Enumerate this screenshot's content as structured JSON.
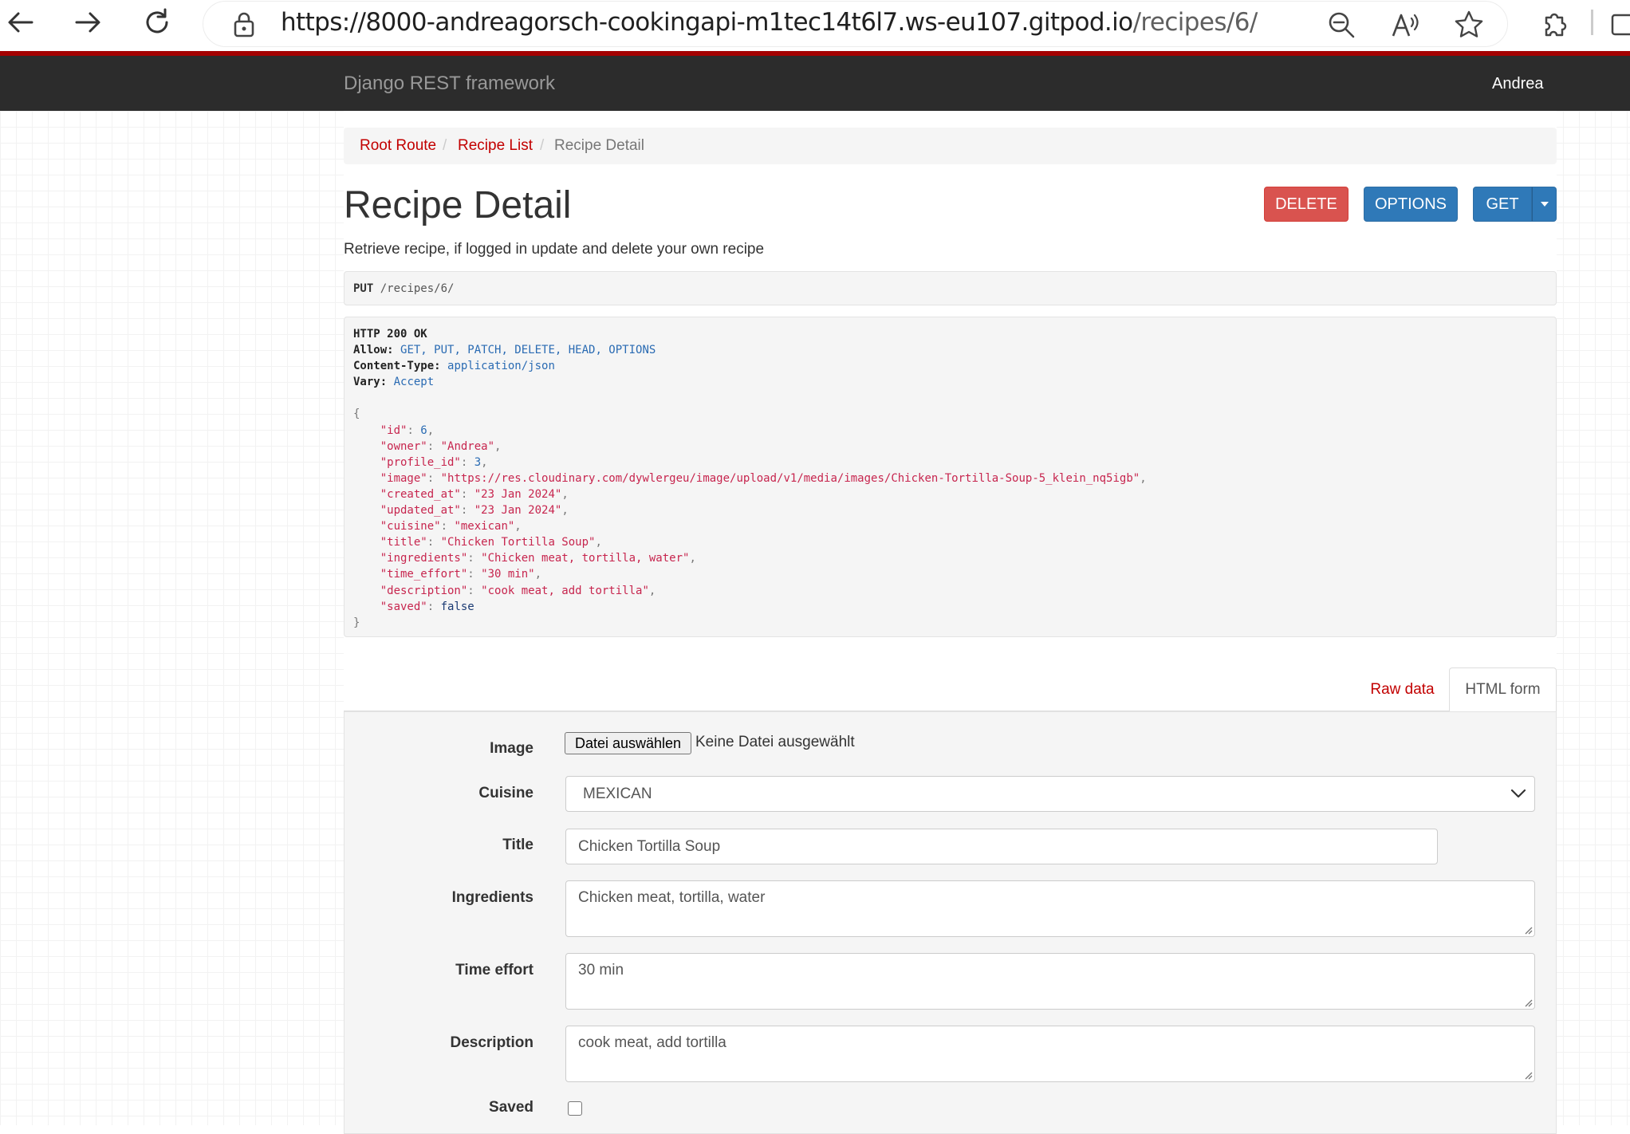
{
  "browser": {
    "url_host": "https://8000-andreagorsch-cookingapi-m1tec14t6l7.ws-eu107.gitpod.io",
    "url_path": "/recipes/6/",
    "icons": [
      "back-icon",
      "forward-icon",
      "reload-icon",
      "lock-icon",
      "zoom-out-icon",
      "read-aloud-icon",
      "favorite-star-icon",
      "extensions-icon",
      "sidebar-icon"
    ]
  },
  "navbar": {
    "brand": "Django REST framework",
    "user": "Andrea"
  },
  "breadcrumb": [
    {
      "label": "Root Route",
      "sep": "/"
    },
    {
      "label": "Recipe List",
      "sep": "/"
    },
    {
      "label": "Recipe Detail"
    }
  ],
  "page": {
    "title": "Recipe Detail",
    "description": "Retrieve recipe, if logged in update and delete your own recipe"
  },
  "buttons": {
    "delete": "DELETE",
    "options": "OPTIONS",
    "get": "GET"
  },
  "request": {
    "method": "PUT",
    "path": "/recipes/6/"
  },
  "response": {
    "status": "HTTP 200 OK",
    "headers": [
      {
        "name": "Allow:",
        "value": "GET, PUT, PATCH, DELETE, HEAD, OPTIONS"
      },
      {
        "name": "Content-Type:",
        "value": "application/json"
      },
      {
        "name": "Vary:",
        "value": "Accept"
      }
    ],
    "open_brace": "{",
    "close_brace": "}",
    "fields": [
      {
        "key": "\"id\"",
        "value": "6",
        "type": "num"
      },
      {
        "key": "\"owner\"",
        "value": "\"Andrea\"",
        "type": "str"
      },
      {
        "key": "\"profile_id\"",
        "value": "3",
        "type": "num"
      },
      {
        "key": "\"image\"",
        "value": "\"https://res.cloudinary.com/dywlergeu/image/upload/v1/media/images/Chicken-Tortilla-Soup-5_klein_nq5igb\"",
        "type": "str"
      },
      {
        "key": "\"created_at\"",
        "value": "\"23 Jan 2024\"",
        "type": "str"
      },
      {
        "key": "\"updated_at\"",
        "value": "\"23 Jan 2024\"",
        "type": "str"
      },
      {
        "key": "\"cuisine\"",
        "value": "\"mexican\"",
        "type": "str"
      },
      {
        "key": "\"title\"",
        "value": "\"Chicken Tortilla Soup\"",
        "type": "str"
      },
      {
        "key": "\"ingredients\"",
        "value": "\"Chicken meat, tortilla, water\"",
        "type": "str"
      },
      {
        "key": "\"time_effort\"",
        "value": "\"30 min\"",
        "type": "str"
      },
      {
        "key": "\"description\"",
        "value": "\"cook meat, add tortilla\"",
        "type": "str"
      },
      {
        "key": "\"saved\"",
        "value": "false",
        "type": "lit"
      }
    ]
  },
  "tabs": {
    "raw": "Raw data",
    "html": "HTML form"
  },
  "form": {
    "image_label": "Image",
    "file_button": "Datei auswählen",
    "file_status": "Keine Datei ausgewählt",
    "cuisine_label": "Cuisine",
    "cuisine_value": "MEXICAN",
    "title_label": "Title",
    "title_value": "Chicken Tortilla Soup",
    "ingredients_label": "Ingredients",
    "ingredients_value": "Chicken meat, tortilla, water",
    "time_effort_label": "Time effort",
    "time_effort_value": "30 min",
    "description_label": "Description",
    "description_value": "cook meat, add tortilla",
    "saved_label": "Saved",
    "saved_checked": false
  }
}
